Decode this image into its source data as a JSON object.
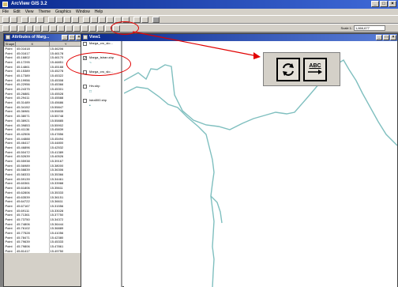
{
  "app": {
    "title": "ArcView GIS 3.2"
  },
  "menu": [
    "File",
    "Edit",
    "View",
    "Theme",
    "Graphics",
    "Window",
    "Help"
  ],
  "toolbar": {
    "scale_label": "Scale 1:",
    "scale_value": "1,666,677"
  },
  "attributes": {
    "title": "Attributes of Marg...",
    "columns": [
      "Shape",
      "X",
      "Y"
    ],
    "rows": [
      [
        "Point",
        "45.01618",
        "15.46206"
      ],
      [
        "Point",
        "45.01617",
        "15.46178"
      ],
      [
        "Point",
        "45.16802",
        "15.46170"
      ],
      [
        "Point",
        "45.17295",
        "15.46851"
      ],
      [
        "Point",
        "45.14861",
        "15.45188"
      ],
      [
        "Point",
        "45.15389",
        "15.45278"
      ],
      [
        "Point",
        "45.17389",
        "15.45322"
      ],
      [
        "Point",
        "45.19956",
        "15.45308"
      ],
      [
        "Point",
        "45.22956",
        "15.45366"
      ],
      [
        "Point",
        "45.24375",
        "15.45301"
      ],
      [
        "Point",
        "45.26881",
        "15.45528"
      ],
      [
        "Point",
        "45.29411",
        "15.45588"
      ],
      [
        "Point",
        "45.31489",
        "15.45686"
      ],
      [
        "Point",
        "45.34152",
        "15.55847"
      ],
      [
        "Point",
        "45.36981",
        "15.55835"
      ],
      [
        "Point",
        "45.38071",
        "15.55748"
      ],
      [
        "Point",
        "45.38921",
        "15.55885"
      ],
      [
        "Point",
        "45.39853",
        "15.55902"
      ],
      [
        "Point",
        "45.41136",
        "15.45839"
      ],
      [
        "Point",
        "45.42506",
        "15.47856"
      ],
      [
        "Point",
        "45.44888",
        "15.45494"
      ],
      [
        "Point",
        "45.46417",
        "15.44800"
      ],
      [
        "Point",
        "45.46896",
        "15.42532"
      ],
      [
        "Point",
        "45.50472",
        "15.41389"
      ],
      [
        "Point",
        "45.52639",
        "15.40526"
      ],
      [
        "Point",
        "45.55938",
        "15.39167"
      ],
      [
        "Point",
        "45.56989",
        "15.38000"
      ],
      [
        "Point",
        "45.58839",
        "15.36306"
      ],
      [
        "Point",
        "45.58333",
        "15.35366"
      ],
      [
        "Point",
        "45.59139",
        "15.34461"
      ],
      [
        "Point",
        "45.60361",
        "15.33988"
      ],
      [
        "Point",
        "45.61806",
        "15.35611"
      ],
      [
        "Point",
        "45.62806",
        "15.35333"
      ],
      [
        "Point",
        "45.63539",
        "15.36151"
      ],
      [
        "Point",
        "45.64722",
        "15.36611"
      ],
      [
        "Point",
        "45.67167",
        "15.31556"
      ],
      [
        "Point",
        "45.69111",
        "15.33028"
      ],
      [
        "Point",
        "45.71361",
        "15.37750"
      ],
      [
        "Point",
        "45.73750",
        "15.34372"
      ],
      [
        "Point",
        "45.74806",
        "15.36444"
      ],
      [
        "Point",
        "45.76102",
        "15.36889"
      ],
      [
        "Point",
        "45.77528",
        "15.41056"
      ],
      [
        "Point",
        "45.78471",
        "15.42380"
      ],
      [
        "Point",
        "45.79639",
        "15.45333"
      ],
      [
        "Point",
        "45.79806",
        "15.47861"
      ],
      [
        "Point",
        "45.81417",
        "15.49750"
      ]
    ]
  },
  "view": {
    "title": "View1",
    "themes": [
      {
        "label": "Marga_cro_slo...",
        "checked": false,
        "symbol": ""
      },
      {
        "label": "Marga_Istran.shp",
        "checked": true,
        "symbol": "~"
      },
      {
        "label": "Marga_cro_slo...",
        "checked": false,
        "symbol": ""
      },
      {
        "label": "Hrv.shp",
        "checked": false,
        "symbol": "□"
      },
      {
        "label": "Istra500.shp",
        "checked": false,
        "symbol": "•"
      }
    ]
  },
  "callout": {
    "refresh_icon": "refresh-icon",
    "label_tool_text": "ABC"
  },
  "colors": {
    "map_line": "#7fbfbf",
    "annotation": "#e10000",
    "titlebar": "#0a2a8f"
  }
}
